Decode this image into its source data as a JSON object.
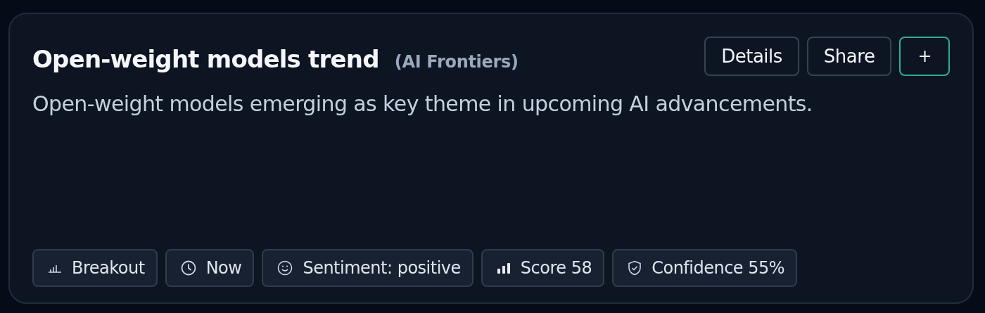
{
  "card": {
    "title": "Open-weight models trend",
    "source": "(AI Frontiers)",
    "description": "Open-weight models emerging as key theme in upcoming AI advancements.",
    "buttons": [
      {
        "label": "Details",
        "kind": "plain"
      },
      {
        "label": "Share",
        "kind": "plain"
      },
      {
        "label": "+",
        "kind": "accent"
      }
    ],
    "chips": [
      {
        "label": "Breakout",
        "kind": "trend"
      },
      {
        "label": "Now",
        "kind": "time"
      },
      {
        "label": "Sentiment: positive",
        "kind": "sentiment"
      },
      {
        "label": "Score 58",
        "kind": "score"
      },
      {
        "label": "Confidence 55%",
        "kind": "confidence"
      }
    ]
  }
}
